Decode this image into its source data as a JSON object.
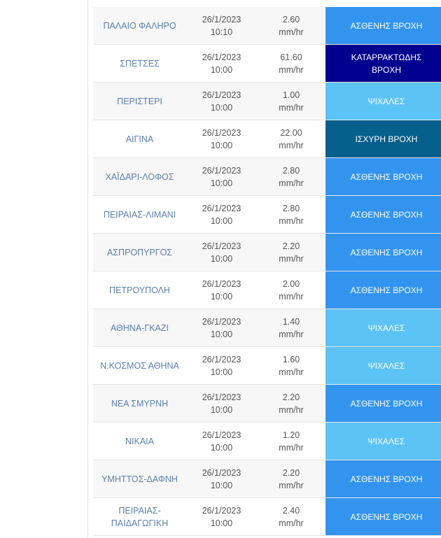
{
  "colors": {
    "weak_rain": "#3394f0",
    "drizzle": "#5cc3f7",
    "heavy_rain": "#065f8c",
    "torrential_rain": "#00008f"
  },
  "rows": [
    {
      "station": "ΠΑΛΑΙΟ ΦΑΛΗΡΟ",
      "date": "26/1/2023",
      "time": "10:10",
      "value": "2.60",
      "unit": "mm/hr",
      "level_lines": [
        "ΑΣΘΕΝΗΣ ΒΡΟΧΗ"
      ],
      "color": "#3394f0"
    },
    {
      "station": "ΣΠΕΤΣΕΣ",
      "date": "26/1/2023",
      "time": "10:00",
      "value": "61.60",
      "unit": "mm/hr",
      "level_lines": [
        "ΚΑΤΑΡΡΑΚΤΩΔΗΣ",
        "ΒΡΟΧΗ"
      ],
      "color": "#00008f"
    },
    {
      "station": "ΠΕΡΙΣΤΕΡΙ",
      "date": "26/1/2023",
      "time": "10:00",
      "value": "1.00",
      "unit": "mm/hr",
      "level_lines": [
        "ΨΙΧΑΛΕΣ"
      ],
      "color": "#5cc3f7"
    },
    {
      "station": "ΑΙΓΙΝΑ",
      "date": "26/1/2023",
      "time": "10:00",
      "value": "22.00",
      "unit": "mm/hr",
      "level_lines": [
        "ΙΣΧΥΡΗ ΒΡΟΧΗ"
      ],
      "color": "#065f8c"
    },
    {
      "station": "ΧΑΪΔΑΡΙ-ΛΟΦΟΣ",
      "date": "26/1/2023",
      "time": "10:00",
      "value": "2.80",
      "unit": "mm/hr",
      "level_lines": [
        "ΑΣΘΕΝΗΣ ΒΡΟΧΗ"
      ],
      "color": "#3394f0"
    },
    {
      "station": "ΠΕΙΡΑΙΑΣ-ΛΙΜΑΝΙ",
      "date": "26/1/2023",
      "time": "10:00",
      "value": "2.80",
      "unit": "mm/hr",
      "level_lines": [
        "ΑΣΘΕΝΗΣ ΒΡΟΧΗ"
      ],
      "color": "#3394f0"
    },
    {
      "station": "ΑΣΠΡΟΠΥΡΓΟΣ",
      "date": "26/1/2023",
      "time": "10:00",
      "value": "2.20",
      "unit": "mm/hr",
      "level_lines": [
        "ΑΣΘΕΝΗΣ ΒΡΟΧΗ"
      ],
      "color": "#3394f0"
    },
    {
      "station": "ΠΕΤΡΟΥΠΟΛΗ",
      "date": "26/1/2023",
      "time": "10:00",
      "value": "2.00",
      "unit": "mm/hr",
      "level_lines": [
        "ΑΣΘΕΝΗΣ ΒΡΟΧΗ"
      ],
      "color": "#3394f0"
    },
    {
      "station": "ΑΘΗΝΑ-ΓΚΑΖΙ",
      "date": "26/1/2023",
      "time": "10:00",
      "value": "1.40",
      "unit": "mm/hr",
      "level_lines": [
        "ΨΙΧΑΛΕΣ"
      ],
      "color": "#5cc3f7"
    },
    {
      "station": "Ν.ΚΟΣΜΟΣ ΑΘΗΝΑ",
      "date": "26/1/2023",
      "time": "10:00",
      "value": "1.60",
      "unit": "mm/hr",
      "level_lines": [
        "ΨΙΧΑΛΕΣ"
      ],
      "color": "#5cc3f7"
    },
    {
      "station": "ΝΕΑ ΣΜΥΡΝΗ",
      "date": "26/1/2023",
      "time": "10:00",
      "value": "2.20",
      "unit": "mm/hr",
      "level_lines": [
        "ΑΣΘΕΝΗΣ ΒΡΟΧΗ"
      ],
      "color": "#3394f0"
    },
    {
      "station": "ΝΙΚΑΙΑ",
      "date": "26/1/2023",
      "time": "10:00",
      "value": "1.20",
      "unit": "mm/hr",
      "level_lines": [
        "ΨΙΧΑΛΕΣ"
      ],
      "color": "#5cc3f7"
    },
    {
      "station": "ΥΜΗΤΤΟΣ-ΔΑΦΝΗ",
      "date": "26/1/2023",
      "time": "10:00",
      "value": "2.20",
      "unit": "mm/hr",
      "level_lines": [
        "ΑΣΘΕΝΗΣ ΒΡΟΧΗ"
      ],
      "color": "#3394f0"
    },
    {
      "station_lines": [
        "ΠΕΙΡΑΙΑΣ-",
        "ΠΑΙΔΑΓΩΓΙΚΗ"
      ],
      "date": "26/1/2023",
      "time": "10:00",
      "value": "2.40",
      "unit": "mm/hr",
      "level_lines": [
        "ΑΣΘΕΝΗΣ ΒΡΟΧΗ"
      ],
      "color": "#3394f0"
    }
  ]
}
